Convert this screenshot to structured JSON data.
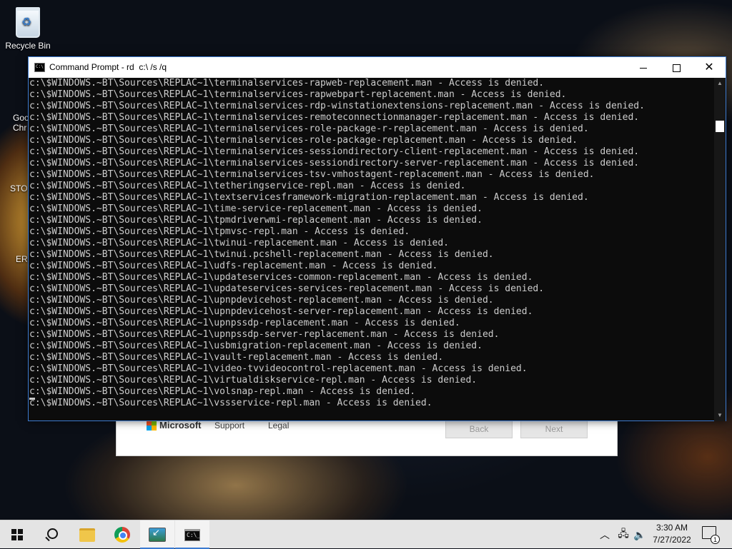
{
  "desktop": {
    "recycle_bin_label": "Recycle Bin",
    "partial_labels": [
      "Goo",
      "Chr",
      "STO",
      "ERR"
    ]
  },
  "setup_window": {
    "brand": "Microsoft",
    "links": [
      "Support",
      "Legal"
    ],
    "back_label": "Back",
    "next_label": "Next"
  },
  "cmd_window": {
    "title": "Command Prompt - rd  c:\\ /s /q",
    "icon_text": "C:\\",
    "lines": [
      "c:\\$WINDOWS.~BT\\Sources\\REPLAC~1\\terminalservices-rapweb-replacement.man - Access is denied.",
      "c:\\$WINDOWS.~BT\\Sources\\REPLAC~1\\terminalservices-rapwebpart-replacement.man - Access is denied.",
      "c:\\$WINDOWS.~BT\\Sources\\REPLAC~1\\terminalservices-rdp-winstationextensions-replacement.man - Access is denied.",
      "c:\\$WINDOWS.~BT\\Sources\\REPLAC~1\\terminalservices-remoteconnectionmanager-replacement.man - Access is denied.",
      "c:\\$WINDOWS.~BT\\Sources\\REPLAC~1\\terminalservices-role-package-r-replacement.man - Access is denied.",
      "c:\\$WINDOWS.~BT\\Sources\\REPLAC~1\\terminalservices-role-package-replacement.man - Access is denied.",
      "c:\\$WINDOWS.~BT\\Sources\\REPLAC~1\\terminalservices-sessiondirectory-client-replacement.man - Access is denied.",
      "c:\\$WINDOWS.~BT\\Sources\\REPLAC~1\\terminalservices-sessiondirectory-server-replacement.man - Access is denied.",
      "c:\\$WINDOWS.~BT\\Sources\\REPLAC~1\\terminalservices-tsv-vmhostagent-replacement.man - Access is denied.",
      "c:\\$WINDOWS.~BT\\Sources\\REPLAC~1\\tetheringservice-repl.man - Access is denied.",
      "c:\\$WINDOWS.~BT\\Sources\\REPLAC~1\\textservicesframework-migration-replacement.man - Access is denied.",
      "c:\\$WINDOWS.~BT\\Sources\\REPLAC~1\\time-service-replacement.man - Access is denied.",
      "c:\\$WINDOWS.~BT\\Sources\\REPLAC~1\\tpmdriverwmi-replacement.man - Access is denied.",
      "c:\\$WINDOWS.~BT\\Sources\\REPLAC~1\\tpmvsc-repl.man - Access is denied.",
      "c:\\$WINDOWS.~BT\\Sources\\REPLAC~1\\twinui-replacement.man - Access is denied.",
      "c:\\$WINDOWS.~BT\\Sources\\REPLAC~1\\twinui.pcshell-replacement.man - Access is denied.",
      "c:\\$WINDOWS.~BT\\Sources\\REPLAC~1\\udfs-replacement.man - Access is denied.",
      "c:\\$WINDOWS.~BT\\Sources\\REPLAC~1\\updateservices-common-replacement.man - Access is denied.",
      "c:\\$WINDOWS.~BT\\Sources\\REPLAC~1\\updateservices-services-replacement.man - Access is denied.",
      "c:\\$WINDOWS.~BT\\Sources\\REPLAC~1\\upnpdevicehost-replacement.man - Access is denied.",
      "c:\\$WINDOWS.~BT\\Sources\\REPLAC~1\\upnpdevicehost-server-replacement.man - Access is denied.",
      "c:\\$WINDOWS.~BT\\Sources\\REPLAC~1\\upnpssdp-replacement.man - Access is denied.",
      "c:\\$WINDOWS.~BT\\Sources\\REPLAC~1\\upnpssdp-server-replacement.man - Access is denied.",
      "c:\\$WINDOWS.~BT\\Sources\\REPLAC~1\\usbmigration-replacement.man - Access is denied.",
      "c:\\$WINDOWS.~BT\\Sources\\REPLAC~1\\vault-replacement.man - Access is denied.",
      "c:\\$WINDOWS.~BT\\Sources\\REPLAC~1\\video-tvvideocontrol-replacement.man - Access is denied.",
      "c:\\$WINDOWS.~BT\\Sources\\REPLAC~1\\virtualdiskservice-repl.man - Access is denied.",
      "c:\\$WINDOWS.~BT\\Sources\\REPLAC~1\\volsnap-repl.man - Access is denied.",
      "c:\\$WINDOWS.~BT\\Sources\\REPLAC~1\\vssservice-repl.man - Access is denied."
    ]
  },
  "taskbar": {
    "time": "3:30 AM",
    "date": "7/27/2022",
    "notification_count": "1",
    "pinned_icons": [
      "start-icon",
      "search-icon",
      "file-explorer-icon",
      "chrome-icon",
      "media-creation-tool-icon",
      "command-prompt-icon"
    ],
    "tray_icons": [
      "chevron-up-icon",
      "network-icon",
      "volume-icon"
    ],
    "accent_color": "#3b7bd0"
  },
  "colors": {
    "console_bg": "#0c0c0c",
    "console_text": "#cccccc"
  }
}
